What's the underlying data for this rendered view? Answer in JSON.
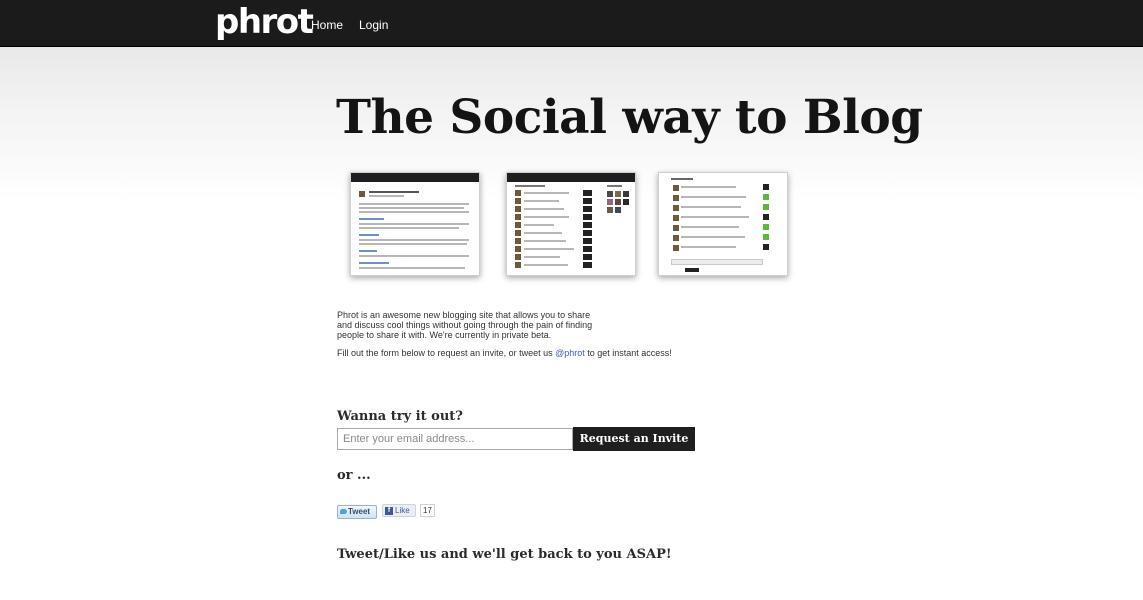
{
  "header": {
    "logo": "phrot",
    "nav": [
      {
        "label": "Home"
      },
      {
        "label": "Login"
      }
    ]
  },
  "hero": {
    "headline": "The Social way to Blog",
    "screenshots": [
      {
        "name": "blog-post-preview"
      },
      {
        "name": "popular-posts-preview"
      },
      {
        "name": "comments-preview"
      }
    ]
  },
  "intro": {
    "text": "Phrot is an awesome new blogging site that allows you to share and discuss cool things without going through the pain of finding people to share it with. We're currently in private beta.",
    "fill_prefix": "Fill out the form below to request an invite, or tweet us ",
    "handle": "@phrot",
    "fill_suffix": " to get instant access!"
  },
  "signup": {
    "heading": "Wanna try it out?",
    "email_placeholder": "Enter your email address...",
    "button_label": "Request an Invite"
  },
  "social": {
    "or_text": "or ...",
    "tweet_label": "Tweet",
    "like_label": "Like",
    "like_count": "17",
    "closing": "Tweet/Like us and we'll get back to you ASAP!"
  },
  "colors": {
    "topbar": "#1c1b1b",
    "link": "#3a5fa8",
    "button": "#1f1f1f",
    "facebook": "#3b5998",
    "twitter": "#4aa3df"
  }
}
